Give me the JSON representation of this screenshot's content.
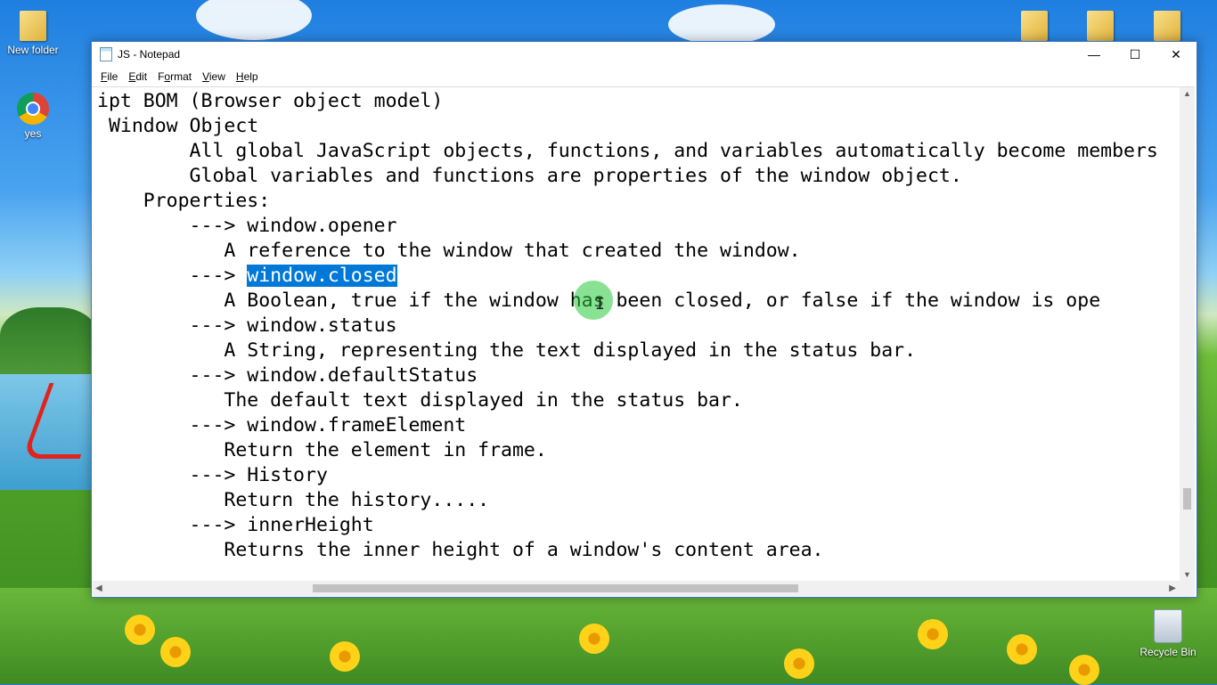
{
  "desktop": {
    "icons": [
      {
        "label": "New folder",
        "icon": "folder-icon"
      },
      {
        "label": "yes",
        "icon": "chrome-icon"
      },
      {
        "label": "Recycle Bin",
        "icon": "recycle-bin-icon"
      }
    ]
  },
  "window": {
    "title": "JS - Notepad",
    "controls": {
      "minimize": "—",
      "maximize": "☐",
      "close": "✕"
    }
  },
  "menu": {
    "file": {
      "accel": "F",
      "rest": "ile"
    },
    "edit": {
      "accel": "E",
      "rest": "dit"
    },
    "format": {
      "accel": "o",
      "pre": "F",
      "rest": "rmat"
    },
    "view": {
      "accel": "V",
      "rest": "iew"
    },
    "help": {
      "accel": "H",
      "rest": "elp"
    }
  },
  "editor": {
    "lines": [
      "ipt BOM (Browser object model)",
      " Window Object",
      "        All global JavaScript objects, functions, and variables automatically become members",
      "        Global variables and functions are properties of the window object.",
      "    Properties:",
      "        ---> window.opener",
      "           A reference to the window that created the window.",
      "        ---> ",
      "           A Boolean, true if the window has been closed, or false if the window is ope",
      "        ---> window.status",
      "           A String, representing the text displayed in the status bar.",
      "        ---> window.defaultStatus",
      "           The default text displayed in the status bar.",
      "        ---> window.frameElement",
      "           Return the element in frame.",
      "        ---> History",
      "           Return the history.....",
      "        ---> innerHeight",
      "           Returns the inner height of a window's content area."
    ],
    "selected_text": "window.closed"
  }
}
